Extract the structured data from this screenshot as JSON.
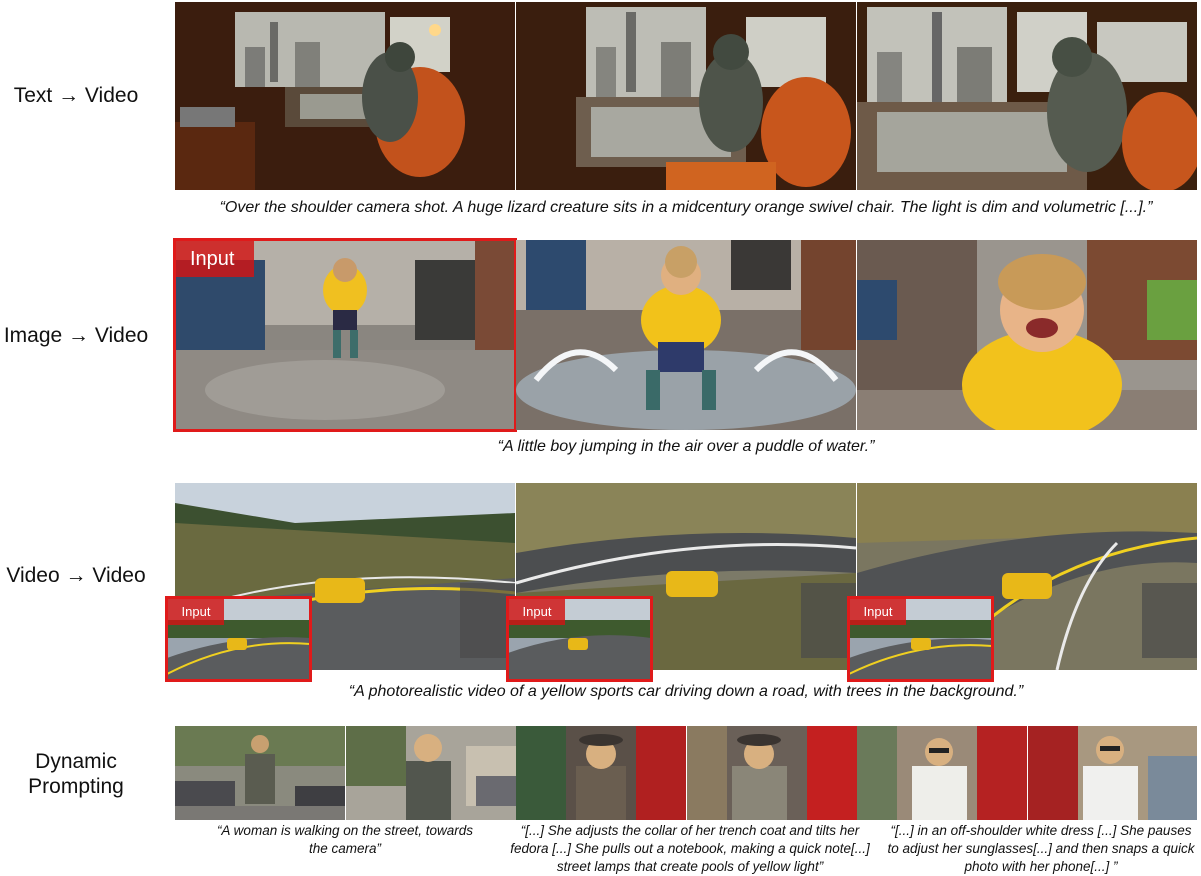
{
  "rows": {
    "t2v": {
      "label": "Text → Video",
      "caption": "“Over the shoulder camera shot. A huge lizard creature sits in a midcentury orange swivel chair. The light is dim and volumetric [...].”"
    },
    "i2v": {
      "label": "Image → Video",
      "caption": "“A little boy jumping in the air over a puddle of water.”",
      "input_tag": "Input"
    },
    "v2v": {
      "label": "Video → Video",
      "caption": "“A photorealistic video of a yellow sports car driving down a road, with trees in the background.”",
      "input_tag": "Input"
    },
    "dyn": {
      "label_line1": "Dynamic",
      "label_line2": "Prompting",
      "caption1": "“A woman is walking on the street, towards the camera”",
      "caption2": "“[...] She adjusts the collar of her trench coat and tilts her fedora [...] She pulls out a notebook, making a quick note[...] street lamps that create pools of yellow light”",
      "caption3": "“[...]  in an off-shoulder white dress [...] She pauses to adjust her sunglasses[...] and then snaps a quick photo with her phone[...] ”"
    }
  },
  "colors": {
    "accent_red": "#e01a1a"
  }
}
